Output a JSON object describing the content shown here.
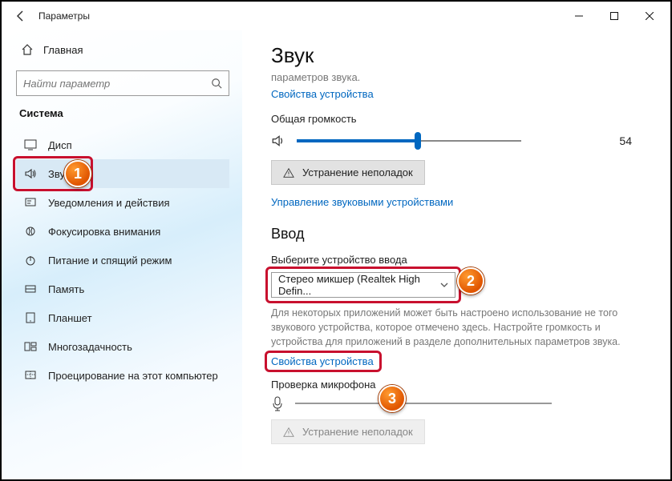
{
  "titlebar": {
    "title": "Параметры"
  },
  "sidebar": {
    "home": "Главная",
    "search_placeholder": "Найти параметр",
    "section": "Система",
    "items": [
      {
        "label": "Дисп"
      },
      {
        "label": "Звук"
      },
      {
        "label": "Уведомления и действия"
      },
      {
        "label": "Фокусировка внимания"
      },
      {
        "label": "Питание и спящий режим"
      },
      {
        "label": "Память"
      },
      {
        "label": "Планшет"
      },
      {
        "label": "Многозадачность"
      },
      {
        "label": "Проецирование на этот компьютер"
      }
    ]
  },
  "main": {
    "title": "Звук",
    "cutoff_line": "параметров звука.",
    "device_props_link": "Свойства устройства",
    "volume_label": "Общая громкость",
    "volume_value": "54",
    "troubleshoot_btn": "Устранение неполадок",
    "manage_devices_link": "Управление звуковыми устройствами",
    "input_heading": "Ввод",
    "input_select_label": "Выберите устройство ввода",
    "input_device": "Стерео микшер (Realtek High Defin...",
    "input_desc": "Для некоторых приложений может быть настроено использование не того звукового устройства, которое отмечено здесь. Настройте громкость и устройства для приложений в разделе дополнительных параметров звука.",
    "device_props_link_2": "Свойства устройства",
    "mic_test_label": "Проверка микрофона",
    "troubleshoot_btn_2": "Устранение неполадок"
  },
  "callouts": {
    "c1": "1",
    "c2": "2",
    "c3": "3"
  },
  "chart_data": {
    "type": "bar",
    "title": "Общая громкость",
    "categories": [
      "volume"
    ],
    "values": [
      54
    ],
    "ylim": [
      0,
      100
    ]
  }
}
